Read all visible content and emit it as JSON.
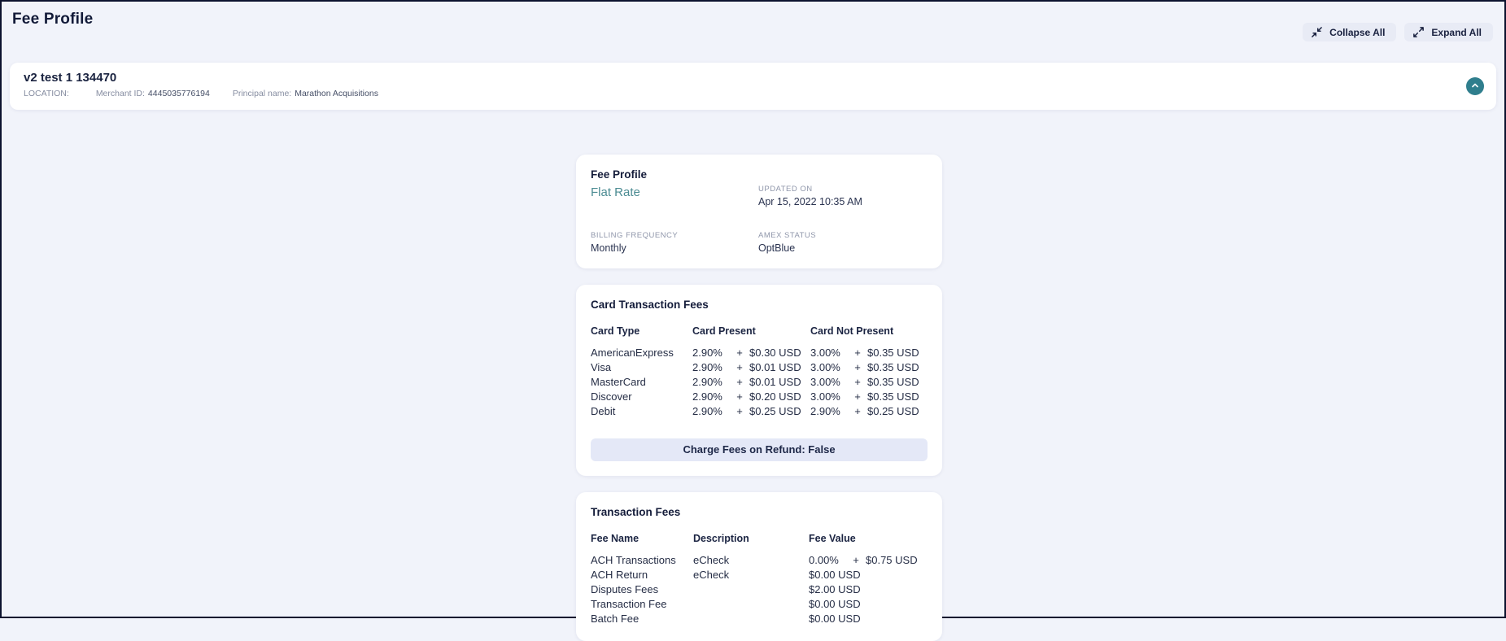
{
  "page": {
    "title": "Fee Profile",
    "actions": {
      "collapse_all": "Collapse All",
      "expand_all": "Expand All"
    }
  },
  "icons": {
    "collapse_icon": "diagonal-arrows-inward",
    "expand_icon": "diagonal-arrows-outward",
    "panel_toggle_icon": "chevron-up"
  },
  "colors": {
    "accent_teal": "#4c8c93",
    "toggle_circle": "#2f7e8d",
    "banner_bg": "#e4e8f7",
    "dark_navy": "#141c3a",
    "page_bg": "#f1f3fa"
  },
  "merchant": {
    "name": "v2 test 1 134470",
    "location_label": "LOCATION:",
    "merchant_id_label": "Merchant ID:",
    "merchant_id": "4445035776194",
    "principal_label": "Principal name:",
    "principal_name": "Marathon Acquisitions"
  },
  "fee_profile": {
    "heading": "Fee Profile",
    "type": "Flat Rate",
    "updated_on_label": "UPDATED ON",
    "updated_on": "Apr 15, 2022 10:35 AM",
    "billing_frequency_label": "BILLING FREQUENCY",
    "billing_frequency": "Monthly",
    "amex_status_label": "AMEX STATUS",
    "amex_status": "OptBlue"
  },
  "card_transaction_fees": {
    "heading": "Card Transaction Fees",
    "columns": [
      "Card Type",
      "Card Present",
      "Card Not Present"
    ],
    "plus": "+",
    "rows": [
      {
        "card_type": "AmericanExpress",
        "cp_rate": "2.90%",
        "cp_amount": "$0.30 USD",
        "cnp_rate": "3.00%",
        "cnp_amount": "$0.35 USD"
      },
      {
        "card_type": "Visa",
        "cp_rate": "2.90%",
        "cp_amount": "$0.01 USD",
        "cnp_rate": "3.00%",
        "cnp_amount": "$0.35 USD"
      },
      {
        "card_type": "MasterCard",
        "cp_rate": "2.90%",
        "cp_amount": "$0.01 USD",
        "cnp_rate": "3.00%",
        "cnp_amount": "$0.35 USD"
      },
      {
        "card_type": "Discover",
        "cp_rate": "2.90%",
        "cp_amount": "$0.20 USD",
        "cnp_rate": "3.00%",
        "cnp_amount": "$0.35 USD"
      },
      {
        "card_type": "Debit",
        "cp_rate": "2.90%",
        "cp_amount": "$0.25 USD",
        "cnp_rate": "2.90%",
        "cnp_amount": "$0.25 USD"
      }
    ],
    "refund_note": "Charge Fees on Refund: False"
  },
  "transaction_fees": {
    "heading": "Transaction Fees",
    "columns": [
      "Fee Name",
      "Description",
      "Fee Value"
    ],
    "plus": "+",
    "rows": [
      {
        "name": "ACH Transactions",
        "description": "eCheck",
        "rate": "0.00%",
        "amount": "$0.75 USD"
      },
      {
        "name": "ACH Return",
        "description": "eCheck",
        "amount": "$0.00 USD"
      },
      {
        "name": "Disputes Fees",
        "description": "",
        "amount": "$2.00 USD"
      },
      {
        "name": "Transaction Fee",
        "description": "",
        "amount": "$0.00 USD"
      },
      {
        "name": "Batch Fee",
        "description": "",
        "amount": "$0.00 USD"
      }
    ]
  }
}
